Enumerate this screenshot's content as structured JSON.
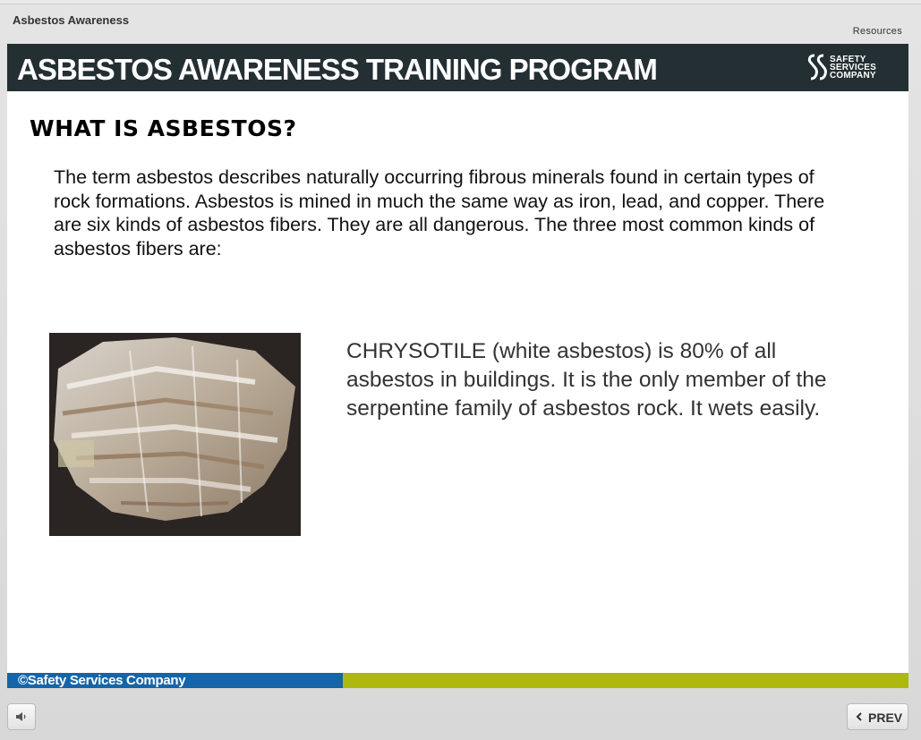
{
  "player": {
    "course_title": "Asbestos Awareness",
    "resources_label": "Resources",
    "prev_label": "PREV"
  },
  "banner": {
    "title": "ASBESTOS AWARENESS TRAINING PROGRAM",
    "logo_lines": [
      "SAFETY",
      "SERVICES",
      "COMPANY"
    ]
  },
  "slide": {
    "heading": "WHAT IS ASBESTOS?",
    "intro": "The term asbestos describes naturally occurring fibrous minerals found in certain types of rock formations.  Asbestos is mined in much the same way as iron, lead, and copper.  There are six kinds of asbestos fibers. They are all dangerous. The three most common kinds of asbestos fibers are:",
    "description": "CHRYSOTILE (white asbestos) is 80% of all asbestos in buildings. It is the only member of the serpentine family of asbestos rock. It wets easily.",
    "photo_icon": "chrysotile-mineral-photo"
  },
  "footer": {
    "copyright": "©Safety Services Company"
  },
  "colors": {
    "banner": "#232f33",
    "footer_blue": "#1565a8",
    "footer_green": "#adb90f"
  }
}
